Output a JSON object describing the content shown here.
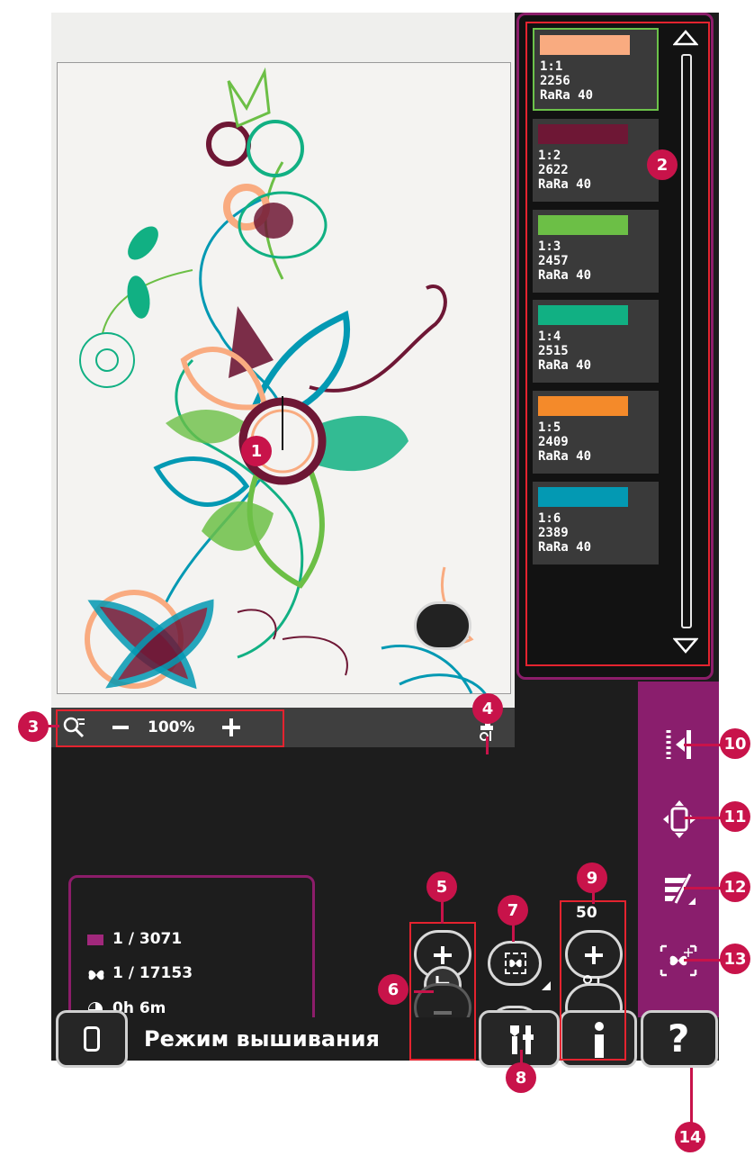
{
  "zoom": {
    "label": "100%"
  },
  "colors": [
    {
      "id": "1:1",
      "number": "2256",
      "brand": "RaRa 40",
      "swatch": "#f9ab80",
      "selected": true
    },
    {
      "id": "1:2",
      "number": "2622",
      "brand": "RaRa 40",
      "swatch": "#6e1735",
      "selected": false
    },
    {
      "id": "1:3",
      "number": "2457",
      "brand": "RaRa 40",
      "swatch": "#6cbf46",
      "selected": false
    },
    {
      "id": "1:4",
      "number": "2515",
      "brand": "RaRa 40",
      "swatch": "#11b083",
      "selected": false
    },
    {
      "id": "1:5",
      "number": "2409",
      "brand": "RaRa 40",
      "swatch": "#f48a2a",
      "selected": false
    },
    {
      "id": "1:6",
      "number": "2389",
      "brand": "RaRa 40",
      "swatch": "#0399b3",
      "selected": false
    }
  ],
  "info": {
    "color_block": "1 / 3071",
    "stitch": "1 / 17153",
    "time": "0h 6m"
  },
  "speed": {
    "value": "50"
  },
  "mode_title": "Режим вышивания",
  "badges": [
    "1",
    "2",
    "3",
    "4",
    "5",
    "6",
    "7",
    "8",
    "9",
    "10",
    "11",
    "12",
    "13",
    "14"
  ],
  "accent": {
    "purple": "#8a1e6d",
    "badge": "#c8134a",
    "outline": "#e4232f"
  }
}
